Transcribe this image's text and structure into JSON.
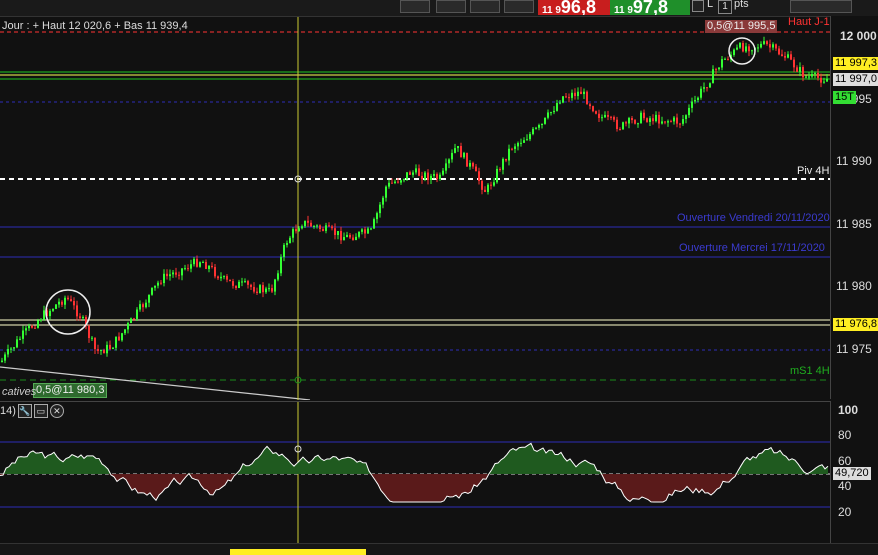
{
  "colors": {
    "up": "#33ff33",
    "down": "#ff3333",
    "hline_blue": "#2d2db8",
    "pivot": "#ffffff",
    "green_line": "#1a8a1a",
    "accent_yellow": "#ffff55"
  },
  "topbar": {
    "bid_prefix": "11 9",
    "bid_big": "96,8",
    "ask_prefix": "11 9",
    "ask_big": "97,8",
    "qty": "1",
    "unit": "pts",
    "option_l": "L"
  },
  "header": {
    "info": "Jour : + Haut 12 020,6 + Bas 11 939,4"
  },
  "annotations": {
    "top_marker": "0,5@11 995,5",
    "haut_j1": "Haut J-1",
    "bottom_marker": "0,5@11 980,3",
    "piv": "Piv 4H",
    "open_fri": "Ouverture Vendredi 20/11/2020",
    "open_wed": "Ouverture Mercrei 17/11/2020",
    "ms1": "mS1 4H",
    "left_cut": "catives"
  },
  "price_axis": {
    "ticks": [
      "12 000",
      "11 995",
      "11 990",
      "11 985",
      "11 980",
      "11 975"
    ],
    "tag_yellow_top": "11 997,3",
    "tag_last": "11 997,0",
    "tag_green": "15T",
    "tag_yellow_bottom": "11 976,8"
  },
  "indicator": {
    "period_label": "14)",
    "axis_ticks": [
      "100",
      "80",
      "60",
      "40",
      "20"
    ],
    "current_value": "49,720"
  },
  "icons": [
    "wrench-icon",
    "window-icon",
    "close-icon"
  ]
}
